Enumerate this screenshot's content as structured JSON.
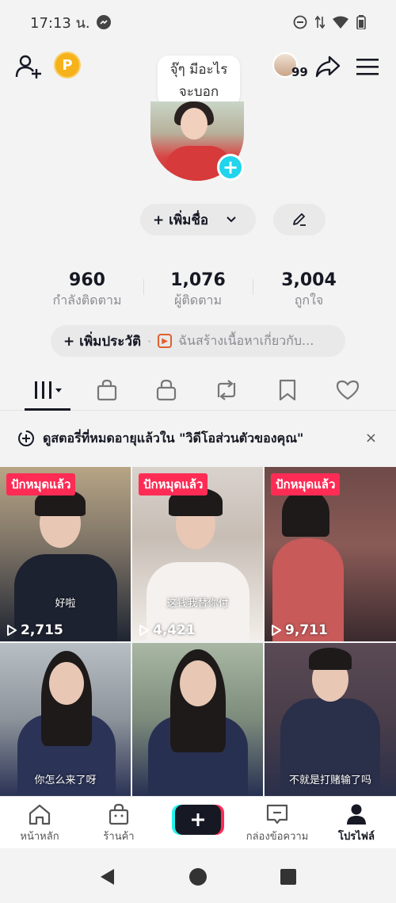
{
  "status_bar": {
    "time": "17:13 น."
  },
  "profile": {
    "note_bubble_line1": "จุ๊ๆ มีอะไร",
    "note_bubble_line2": "จะบอก",
    "friends_badge_count": "99",
    "coin_letter": "P",
    "add_name_label": "+ เพิ่มชื่อ",
    "stats": [
      {
        "value": "960",
        "label": "กำลังติดตาม"
      },
      {
        "value": "1,076",
        "label": "ผู้ติดตาม"
      },
      {
        "value": "3,004",
        "label": "ถูกใจ"
      }
    ],
    "add_bio_label": "+ เพิ่มประวัติ",
    "bio_separator": "·",
    "bio_suggestion": "ฉันสร้างเนื้อหาเกี่ยวกับ..."
  },
  "tabs": [
    "videos-icon",
    "shop-icon",
    "lock-icon",
    "repost-icon",
    "bookmark-icon",
    "heart-icon"
  ],
  "notice": {
    "text": "ดูสตอรี่ที่หมดอายุแล้วใน \"วิดีโอส่วนตัวของคุณ\"",
    "close": "×"
  },
  "videos": [
    {
      "pinned": "ปักหมุดแล้ว",
      "views": "2,715",
      "subtitle": "好啦",
      "colors": [
        "#b7a585",
        "#1f2532"
      ]
    },
    {
      "pinned": "ปักหมุดแล้ว",
      "views": "4,421",
      "subtitle": "这钱我替你付",
      "colors": [
        "#d9d2cc",
        "#f3eee9"
      ]
    },
    {
      "pinned": "ปักหมุดแล้ว",
      "views": "9,711",
      "subtitle": "",
      "colors": [
        "#6e4a48",
        "#c85a5a"
      ]
    },
    {
      "pinned": "",
      "views": "",
      "subtitle": "你怎么来了呀",
      "colors": [
        "#b8bfc4",
        "#2b3356"
      ]
    },
    {
      "pinned": "",
      "views": "",
      "subtitle": "",
      "colors": [
        "#a9b7a4",
        "#283052"
      ]
    },
    {
      "pinned": "",
      "views": "",
      "subtitle": "不就是打赌输了吗",
      "colors": [
        "#5a4a55",
        "#2a2f4a"
      ]
    }
  ],
  "bottom_nav": {
    "home": "หน้าหลัก",
    "shop": "ร้านค้า",
    "inbox": "กล่องข้อความ",
    "profile": "โปรไฟล์"
  },
  "accent": {
    "tiktok_red": "#fe2c55",
    "tiktok_cyan": "#25f4ee",
    "add_blue": "#20d5ec"
  }
}
